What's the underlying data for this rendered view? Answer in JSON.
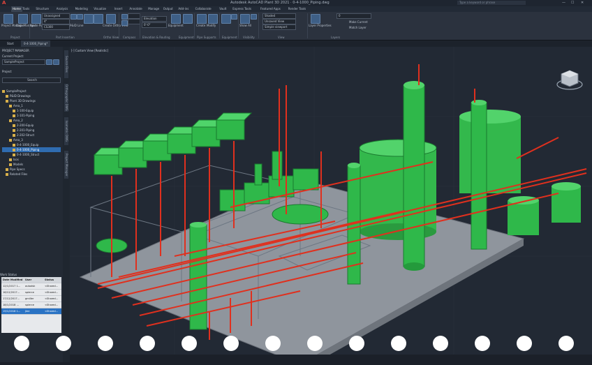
{
  "app": {
    "logo": "A",
    "window_title": "Autodesk AutoCAD Plant 3D 2021  ·  0-4-1000_Piping.dwg",
    "search_placeholder": "Type a keyword or phrase",
    "win_controls": [
      "—",
      "☐",
      "✕"
    ]
  },
  "menubar": {
    "tabs": [
      "Home",
      "Tools",
      "Structure",
      "Analysis",
      "Modeling",
      "Visualize",
      "Insert",
      "Annotate",
      "Manage",
      "Output",
      "Add-ins",
      "Collaborate",
      "Vault",
      "Express Tools",
      "Featured Apps",
      "Render Tools"
    ],
    "active": "Home"
  },
  "ribbon": {
    "groups": [
      {
        "name": "Project",
        "buttons": [
          "Project Manager",
          "Data Manager"
        ]
      },
      {
        "name": "Part Insertion",
        "buttons": [
          "Route Pipe",
          "P&ID Line",
          "Plant Line"
        ],
        "combos": [
          "Unassigned",
          "4\"",
          "CS300"
        ]
      },
      {
        "name": "Ortho View",
        "buttons": [
          "Create Ortho View"
        ]
      },
      {
        "name": "Compass",
        "buttons": []
      },
      {
        "name": "Elevation & Routing",
        "combos": [
          "Elevation",
          "0'-0\""
        ]
      },
      {
        "name": "Equipment",
        "buttons": [
          "Equipment",
          "Create",
          "Modify"
        ]
      },
      {
        "name": "Pipe Supports",
        "buttons": [
          "Create",
          "Modify"
        ]
      },
      {
        "name": "Equipment",
        "buttons": [
          "Cut Plane",
          "Attach"
        ]
      },
      {
        "name": "Visibility",
        "buttons": [
          "Show All",
          "Hide"
        ]
      },
      {
        "name": "View",
        "combos": [
          "Shaded",
          "Unsaved View",
          "Simple viewport"
        ]
      },
      {
        "name": "Layers",
        "buttons": [
          "Layer Properties",
          "Make Current",
          "Match Layer"
        ],
        "combos": [
          "0"
        ]
      }
    ]
  },
  "doc_tabs": [
    "Start",
    "0-4-1000_Piping*"
  ],
  "left_panel": {
    "title": "PROJECT MANAGER",
    "current_project_label": "Current Project:",
    "current_project": "SampleProject",
    "project_label": "Project",
    "search_placeholder": "Search",
    "tree": [
      {
        "label": "SampleProject",
        "indent": 0
      },
      {
        "label": "P&ID Drawings",
        "indent": 1
      },
      {
        "label": "Plant 3D Drawings",
        "indent": 1
      },
      {
        "label": "Area_1",
        "indent": 2
      },
      {
        "label": "1-100-Equip",
        "indent": 3
      },
      {
        "label": "1-101-Piping",
        "indent": 3
      },
      {
        "label": "Area_2",
        "indent": 2
      },
      {
        "label": "2-200-Equip",
        "indent": 3
      },
      {
        "label": "2-201-Piping",
        "indent": 3
      },
      {
        "label": "2-202-Struct",
        "indent": 3
      },
      {
        "label": "Area_3",
        "indent": 2
      },
      {
        "label": "0-4-1000_Equip",
        "indent": 3
      },
      {
        "label": "0-4-1000_Piping",
        "indent": 3,
        "selected": true
      },
      {
        "label": "0-4-1000_Struct",
        "indent": 3
      },
      {
        "label": "Isos",
        "indent": 2
      },
      {
        "label": "Models",
        "indent": 2
      },
      {
        "label": "Pipe Specs",
        "indent": 1
      },
      {
        "label": "Related Files",
        "indent": 1
      }
    ],
    "vertical_tabs": [
      "Source Files",
      "Orthographic DWG",
      "Isometric DWG",
      "Project Manager"
    ]
  },
  "work_status": {
    "title": "Work Status",
    "columns": [
      "Date Modified",
      "User",
      "Status"
    ],
    "rows": [
      {
        "date": "12/1/2017 1...",
        "user": "autodsk",
        "status": "<Shared..."
      },
      {
        "date": "16/12/2017...",
        "user": "spierce",
        "status": "<Shared..."
      },
      {
        "date": "17/12/2017...",
        "user": "gmiller",
        "status": "<Shared..."
      },
      {
        "date": "18/1/2018 ...",
        "user": "spierce",
        "status": "<Shared..."
      },
      {
        "date": "19/1/2018 1...",
        "user": "jlee",
        "status": "<Shared...",
        "selected": true
      }
    ]
  },
  "viewport": {
    "label": "[-] Custom View [Realistic]",
    "cube_face": "TOP",
    "colors": {
      "equipment": "#2fb84a",
      "piping": "#e0301e",
      "slab": "#9aa0a8",
      "steel": "#707a86",
      "background": "#222934"
    }
  },
  "footer_holes": 14
}
